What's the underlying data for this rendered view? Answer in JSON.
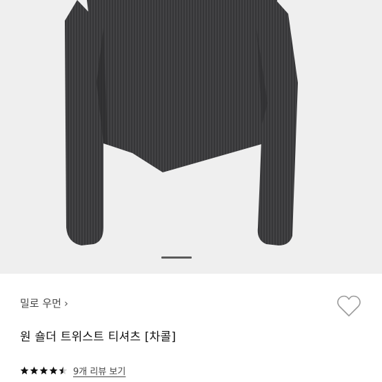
{
  "product": {
    "brand": "밀로 우먼",
    "brand_chevron": "›",
    "title": "원 숄더 트위스트 티셔츠 [차콜]",
    "rating": 4.5,
    "rating_max": 5,
    "reviews_link": "9개 리뷰 보기",
    "color": "#3b3b3d"
  },
  "gallery": {
    "current_slide_indicator": "pager-bar",
    "background": "#efefef"
  },
  "icons": {
    "wishlist": "heart-outline-icon",
    "star": "star-icon"
  }
}
